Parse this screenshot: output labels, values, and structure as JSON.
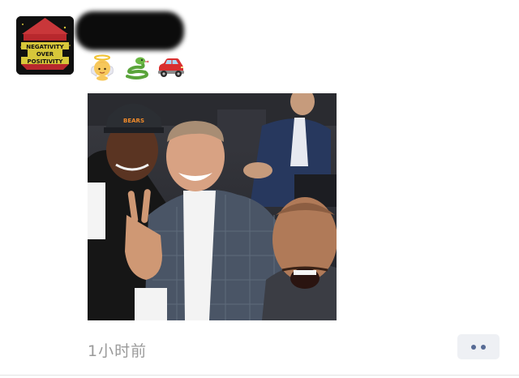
{
  "post": {
    "avatar": {
      "lines": [
        "NEGATIVITY",
        "OVER",
        "POSITIVITY"
      ]
    },
    "status_icons": [
      "baby-angel-icon",
      "snake-icon",
      "red-car-icon"
    ],
    "photo": {
      "cap_text": "BEARS"
    },
    "timestamp": "1小时前"
  },
  "colors": {
    "timestamp_gray": "#9a9a9a",
    "more_dots_blue": "#576b95",
    "more_button_bg": "#eef0f4"
  }
}
